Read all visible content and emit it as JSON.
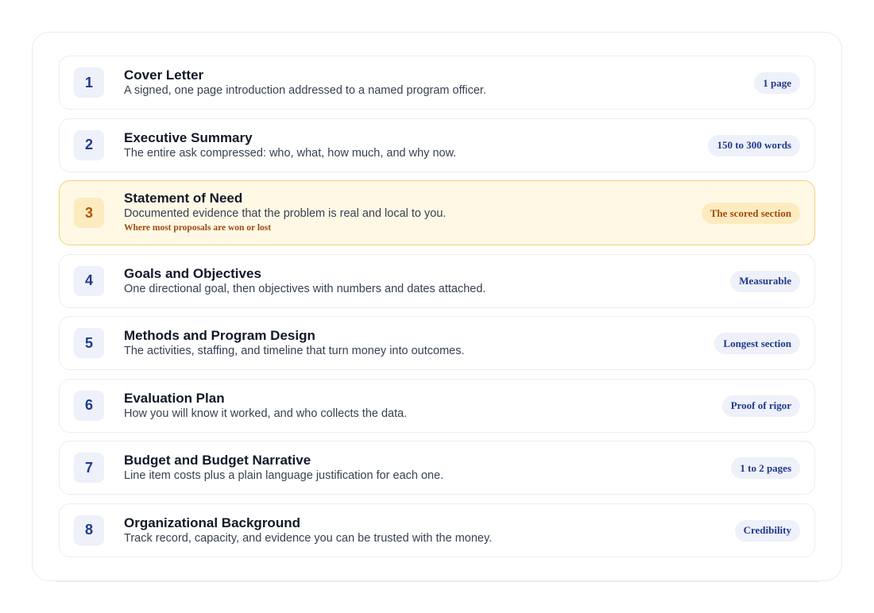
{
  "sections": [
    {
      "number": "1",
      "title": "Cover Letter",
      "description": "A signed, one page introduction addressed to a named program officer.",
      "badge": "1 page"
    },
    {
      "number": "2",
      "title": "Executive Summary",
      "description": "The entire ask compressed: who, what, how much, and why now.",
      "badge": "150 to 300 words"
    },
    {
      "number": "3",
      "title": "Statement of Need",
      "description": "Documented evidence that the problem is real and local to you.",
      "note": "Where most proposals are won or lost",
      "badge": "The scored section"
    },
    {
      "number": "4",
      "title": "Goals and Objectives",
      "description": "One directional goal, then objectives with numbers and dates attached.",
      "badge": "Measurable"
    },
    {
      "number": "5",
      "title": "Methods and Program Design",
      "description": "The activities, staffing, and timeline that turn money into outcomes.",
      "badge": "Longest section"
    },
    {
      "number": "6",
      "title": "Evaluation Plan",
      "description": "How you will know it worked, and who collects the data.",
      "badge": "Proof of rigor"
    },
    {
      "number": "7",
      "title": "Budget and Budget Narrative",
      "description": "Line item costs plus a plain language justification for each one.",
      "badge": "1 to 2 pages"
    },
    {
      "number": "8",
      "title": "Organizational Background",
      "description": "Track record, capacity, and evidence you can be trusted with the money.",
      "badge": "Credibility"
    }
  ],
  "colors": {
    "accent": "#1f3a8a",
    "highlight_bg": "#fff8e5",
    "highlight_border": "#f1d27a",
    "highlight_text": "#b45309"
  }
}
